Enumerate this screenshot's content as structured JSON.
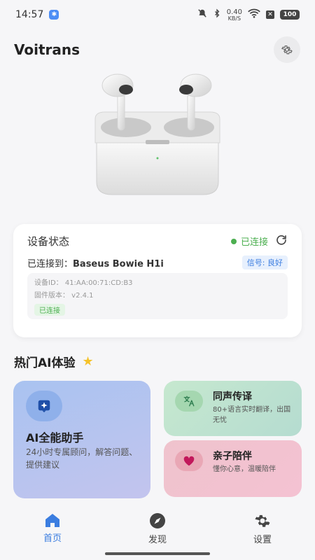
{
  "status_bar": {
    "time": "14:57",
    "bt_badge": "✱",
    "net_speed_value": "0.40",
    "net_speed_unit": "KB/S",
    "battery": "100"
  },
  "header": {
    "app_title": "Voitrans"
  },
  "device": {
    "card_title": "设备状态",
    "status_text": "已连接",
    "connected_prefix": "已连接到：",
    "device_name": "Baseus Bowie H1i",
    "signal": "信号: 良好",
    "device_id": "设备ID： 41:AA:00:71:CD:B3",
    "firmware": "固件版本： v2.4.1",
    "status_badge": "已连接"
  },
  "section": {
    "title": "热门AI体验"
  },
  "features": {
    "ai_assistant": {
      "title": "AI全能助手",
      "desc": "24小时专属顾问，解答问题、提供建议"
    },
    "translation": {
      "title": "同声传译",
      "desc": "80+语言实时翻译，出国无忧"
    },
    "parenting": {
      "title": "亲子陪伴",
      "desc": "懂你心意，温暖陪伴"
    }
  },
  "nav": {
    "home": "首页",
    "discover": "发现",
    "settings": "设置"
  },
  "colors": {
    "accent": "#3b7de0",
    "connected_green": "#4caf50",
    "star": "#f5c22a"
  },
  "icons": {
    "settings": "gear-icon",
    "refresh": "refresh-icon",
    "home": "home-icon",
    "discover": "compass-icon",
    "nav_settings": "gear-icon"
  }
}
